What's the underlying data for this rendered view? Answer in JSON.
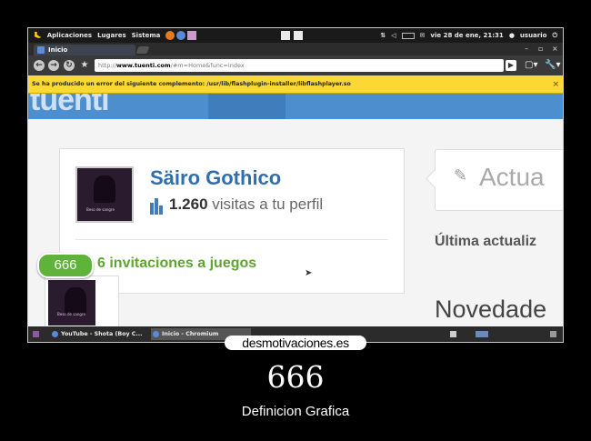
{
  "panel": {
    "applications": "Aplicaciones",
    "places": "Lugares",
    "system": "Sistema",
    "datetime": "vie 28 de ene, 21:31",
    "user": "usuario"
  },
  "browser": {
    "tab_title": "Inicio",
    "url_prefix": "http://",
    "url_domain": "www.tuenti.com",
    "url_path": "/#m=Home&func=index"
  },
  "infobar": {
    "message": "Se ha producido un error del siguiente complemento: /usr/lib/flashplugin-installer/libflashplayer.so"
  },
  "page": {
    "logo": "tuenti",
    "profile_name": "Säiro Gothico",
    "visits_count": "1.260",
    "visits_text": " visitas a tu perfil",
    "invitations": "6 invitaciones a juegos",
    "status_placeholder": "Actua",
    "last_update": "Última actualiz",
    "news": "Novedade",
    "avatar_caption": "Beso de sangre"
  },
  "taskbar": {
    "task1": "YouTube - Shota (Boy C...",
    "task2": "Inicio - Chromium"
  },
  "poster": {
    "site": "desmotivaciones.es",
    "badge": "666",
    "title": "666",
    "subtitle": "Definicion Grafica"
  },
  "colors": {
    "tuenti_blue": "#4d8ecf",
    "name_blue": "#2f6fb0",
    "green": "#5fa531",
    "infobar_yellow": "#fdd835"
  }
}
